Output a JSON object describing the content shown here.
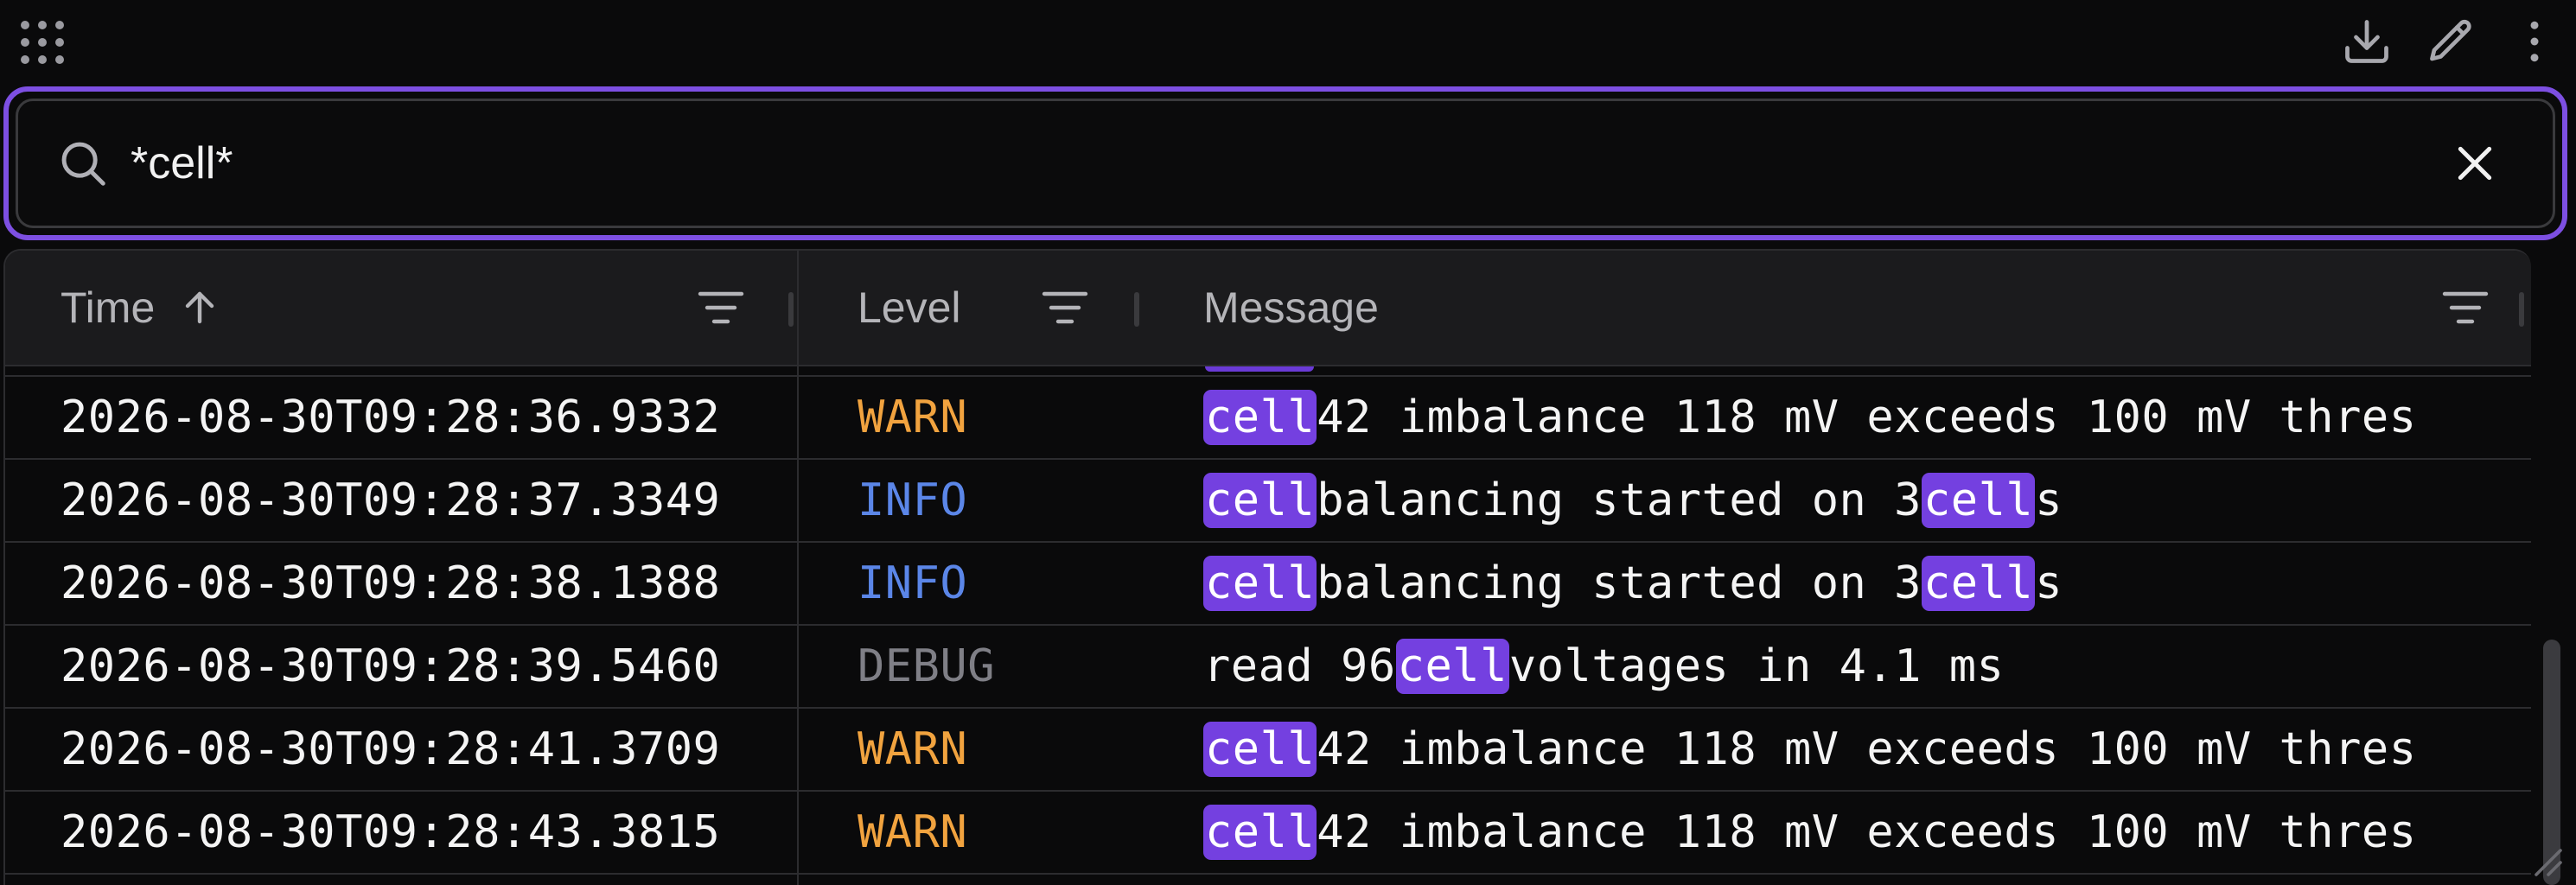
{
  "toolbar": {
    "apps_icon": "grid-dots-icon",
    "download_icon": "download-icon",
    "edit_icon": "pencil-icon",
    "more_icon": "more-vertical-icon"
  },
  "search": {
    "value": "*cell*",
    "search_icon": "search-icon",
    "clear_icon": "close-icon"
  },
  "highlight_term": "cell",
  "colors": {
    "accent": "#7d4fe2",
    "highlight": "#7440e0",
    "warn": "#f1a33f",
    "info": "#5b86e8",
    "debug": "#7f7f86"
  },
  "table": {
    "columns": [
      {
        "key": "time",
        "label": "Time",
        "sort": "ascending"
      },
      {
        "key": "level",
        "label": "Level"
      },
      {
        "key": "message",
        "label": "Message"
      }
    ],
    "rows": [
      {
        "time": "2026-08-30T09:28:36.9332",
        "level": "WARN",
        "message": "cell 42 imbalance 118 mV exceeds 100 mV thres"
      },
      {
        "time": "2026-08-30T09:28:37.3349",
        "level": "INFO",
        "message": "cell balancing started on 3 cells"
      },
      {
        "time": "2026-08-30T09:28:38.1388",
        "level": "INFO",
        "message": "cell balancing started on 3 cells"
      },
      {
        "time": "2026-08-30T09:28:39.5460",
        "level": "DEBUG",
        "message": "read 96 cell voltages in 4.1 ms"
      },
      {
        "time": "2026-08-30T09:28:41.3709",
        "level": "WARN",
        "message": "cell 42 imbalance 118 mV exceeds 100 mV thres"
      },
      {
        "time": "2026-08-30T09:28:43.3815",
        "level": "WARN",
        "message": "cell 42 imbalance 118 mV exceeds 100 mV thres"
      }
    ]
  }
}
